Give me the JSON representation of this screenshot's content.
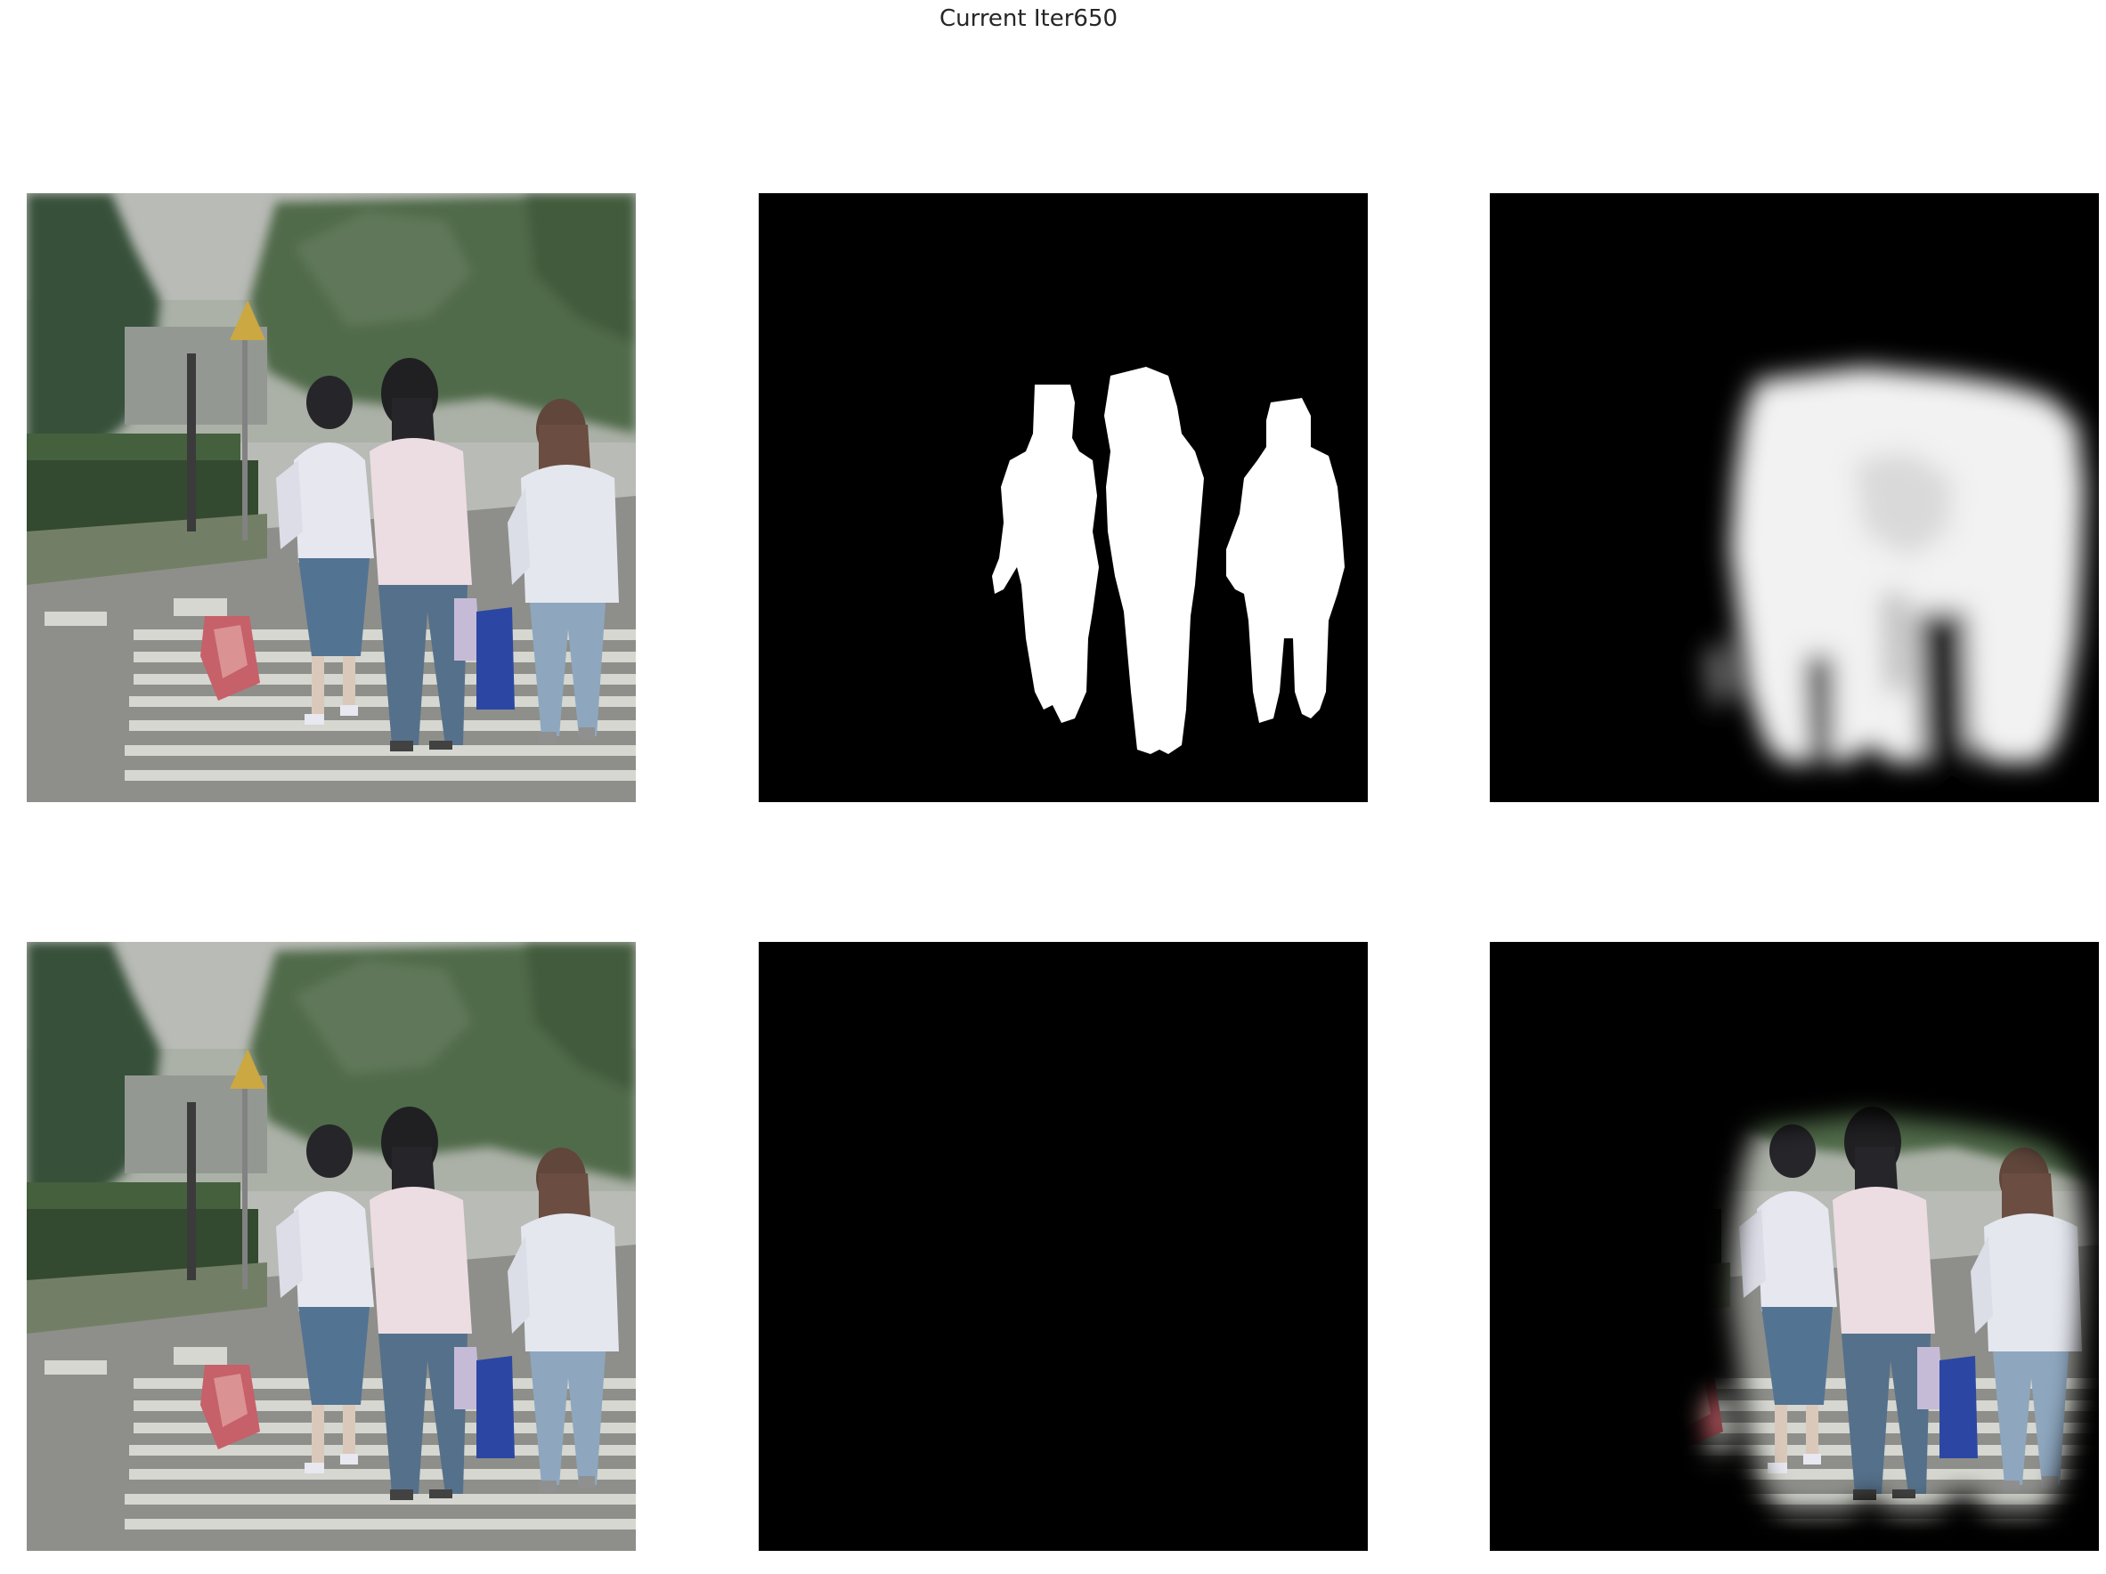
{
  "figure": {
    "title": "Current Iter650"
  },
  "panels": [
    {
      "row": 1,
      "col": 1,
      "content": "input-photo",
      "name": "input-image"
    },
    {
      "row": 1,
      "col": 2,
      "content": "ground-truth-mask",
      "name": "ground-truth-mask"
    },
    {
      "row": 1,
      "col": 3,
      "content": "predicted-mask",
      "name": "predicted-mask"
    },
    {
      "row": 2,
      "col": 1,
      "content": "input-photo",
      "name": "input-image-copy"
    },
    {
      "row": 2,
      "col": 2,
      "content": "ground-truth-cutout",
      "name": "ground-truth-cutout"
    },
    {
      "row": 2,
      "col": 3,
      "content": "predicted-cutout",
      "name": "predicted-cutout"
    }
  ],
  "colors": {
    "background": "#ffffff",
    "mask_background": "#000000",
    "mask_foreground": "#ffffff",
    "title_text": "#262626"
  }
}
